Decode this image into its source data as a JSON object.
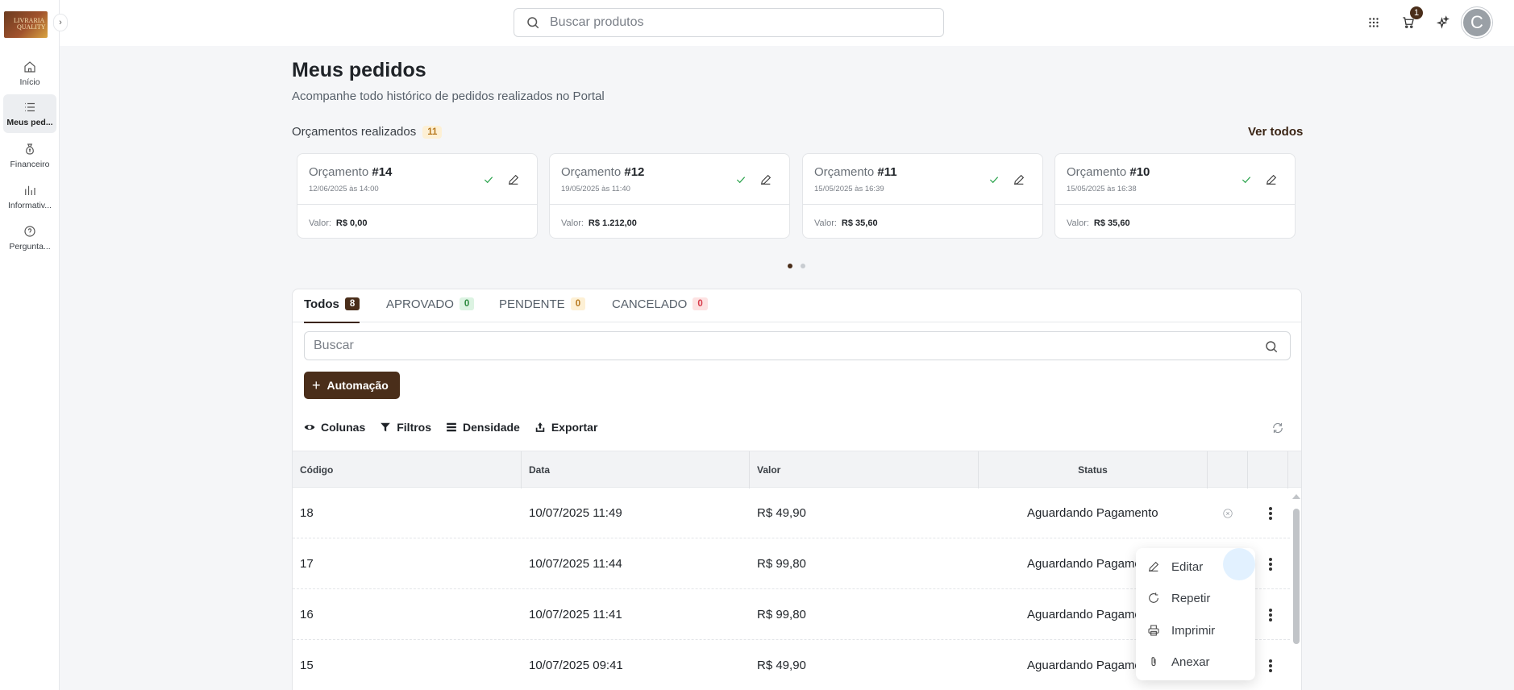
{
  "app": {
    "logo_text_1": "LIVRARIA",
    "logo_text_2": "QUALITY",
    "collapse_glyph": "›"
  },
  "sidebar": {
    "items": [
      {
        "label": "Início",
        "icon": "home-icon",
        "active": false
      },
      {
        "label": "Meus ped...",
        "icon": "list-icon",
        "active": true
      },
      {
        "label": "Financeiro",
        "icon": "money-bag-icon",
        "active": false
      },
      {
        "label": "Informativ...",
        "icon": "chart-icon",
        "active": false
      },
      {
        "label": "Pergunta...",
        "icon": "question-icon",
        "active": false
      }
    ]
  },
  "topbar": {
    "search_placeholder": "Buscar produtos",
    "cart_count": "1",
    "avatar_initial": "C"
  },
  "page": {
    "title": "Meus pedidos",
    "subtitle": "Acompanhe todo histórico de pedidos realizados no Portal"
  },
  "quotes": {
    "title": "Orçamentos realizados",
    "count": "11",
    "see_all": "Ver todos",
    "cards": [
      {
        "label": "Orçamento",
        "number": "#14",
        "date": "12/06/2025 às 14:00",
        "value_label": "Valor:",
        "value": "R$ 0,00"
      },
      {
        "label": "Orçamento",
        "number": "#12",
        "date": "19/05/2025 às 11:40",
        "value_label": "Valor:",
        "value": "R$ 1.212,00"
      },
      {
        "label": "Orçamento",
        "number": "#11",
        "date": "15/05/2025 às 16:39",
        "value_label": "Valor:",
        "value": "R$ 35,60"
      },
      {
        "label": "Orçamento",
        "number": "#10",
        "date": "15/05/2025 às 16:38",
        "value_label": "Valor:",
        "value": "R$ 35,60"
      }
    ]
  },
  "tabs": [
    {
      "label": "Todos",
      "count": "8",
      "style": "dark",
      "active": true
    },
    {
      "label": "APROVADO",
      "count": "0",
      "style": "green",
      "active": false
    },
    {
      "label": "PENDENTE",
      "count": "0",
      "style": "orange",
      "active": false
    },
    {
      "label": "CANCELADO",
      "count": "0",
      "style": "red",
      "active": false
    }
  ],
  "table_search_placeholder": "Buscar",
  "automation_button": "Automação",
  "toolbar": {
    "columns": "Colunas",
    "filters": "Filtros",
    "density": "Densidade",
    "export": "Exportar"
  },
  "table": {
    "headers": {
      "code": "Código",
      "date": "Data",
      "value": "Valor",
      "status": "Status"
    },
    "rows": [
      {
        "code": "18",
        "date": "10/07/2025 11:49",
        "value": "R$ 49,90",
        "status": "Aguardando Pagamento"
      },
      {
        "code": "17",
        "date": "10/07/2025 11:44",
        "value": "R$ 99,80",
        "status": "Aguardando Pagame"
      },
      {
        "code": "16",
        "date": "10/07/2025 11:41",
        "value": "R$ 99,80",
        "status": "Aguardando Pagame"
      },
      {
        "code": "15",
        "date": "10/07/2025 09:41",
        "value": "R$ 49,90",
        "status": "Aguardando Pagame"
      }
    ]
  },
  "context_menu": {
    "items": [
      {
        "label": "Editar",
        "icon": "pencil-icon"
      },
      {
        "label": "Repetir",
        "icon": "refresh-icon"
      },
      {
        "label": "Imprimir",
        "icon": "printer-icon"
      },
      {
        "label": "Anexar",
        "icon": "paperclip-icon"
      }
    ]
  },
  "colors": {
    "brand": "#4a2e1a",
    "success": "#2da44e"
  }
}
